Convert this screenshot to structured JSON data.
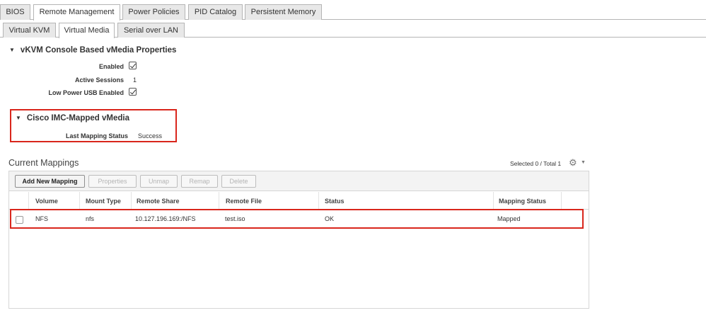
{
  "tabs_top": [
    "BIOS",
    "Remote Management",
    "Power Policies",
    "PID Catalog",
    "Persistent Memory"
  ],
  "tabs_sub": [
    "Virtual KVM",
    "Virtual Media",
    "Serial over LAN"
  ],
  "vkvm": {
    "title": "vKVM Console Based vMedia Properties",
    "enabled_label": "Enabled",
    "enabled_checked": true,
    "active_sessions_label": "Active Sessions",
    "active_sessions_value": "1",
    "low_power_label": "Low Power USB Enabled",
    "low_power_checked": true
  },
  "imc": {
    "title": "Cisco IMC-Mapped vMedia",
    "last_status_label": "Last Mapping Status",
    "last_status_value": "Success"
  },
  "mappings": {
    "title": "Current Mappings",
    "selected_text": "Selected 0 / Total 1",
    "toolbar": {
      "add": "Add New Mapping",
      "properties": "Properties",
      "unmap": "Unmap",
      "remap": "Remap",
      "delete": "Delete"
    },
    "columns": [
      "Volume",
      "Mount Type",
      "Remote Share",
      "Remote File",
      "Status",
      "Mapping Status"
    ],
    "rows": [
      [
        "NFS",
        "nfs",
        "10.127.196.169:/NFS",
        "test.iso",
        "OK",
        "Mapped"
      ]
    ]
  },
  "colors": {
    "highlight": "#d9261c"
  },
  "icons": {
    "settings": "gear-icon",
    "expand": "triangle-down-icon"
  }
}
